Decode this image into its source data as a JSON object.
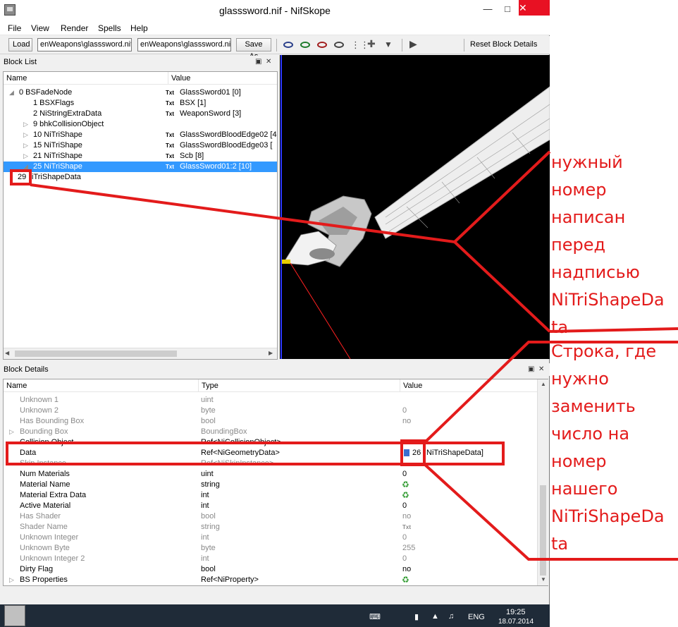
{
  "window": {
    "title": "glasssword.nif - NifSkope"
  },
  "menu": [
    "File",
    "View",
    "Render",
    "Spells",
    "Help"
  ],
  "toolbar": {
    "load_label": "Load",
    "load_path": "enWeapons\\glasssword.nif",
    "save_path": "enWeapons\\glasssword.nif",
    "save_as_label": "Save As",
    "reset_label": "Reset Block Details"
  },
  "block_list": {
    "title": "Block List",
    "col_name": "Name",
    "col_value": "Value",
    "rows": [
      {
        "name": "0 BSFadeNode",
        "value": "GlassSword01 [0]",
        "badge": "Txt"
      },
      {
        "name": "1 BSXFlags",
        "value": "BSX [1]",
        "badge": "Txt"
      },
      {
        "name": "2 NiStringExtraData",
        "value": "WeaponSword [3]",
        "badge": "Txt"
      },
      {
        "name": "9 bhkCollisionObject",
        "value": "",
        "badge": ""
      },
      {
        "name": "10 NiTriShape",
        "value": "GlassSwordBloodEdge02 [4",
        "badge": "Txt"
      },
      {
        "name": "15 NiTriShape",
        "value": "GlassSwordBloodEdge03 [",
        "badge": "Txt"
      },
      {
        "name": "21 NiTriShape",
        "value": "Scb [8]",
        "badge": "Txt"
      },
      {
        "name": "25 NiTriShape",
        "value": "GlassSword01:2 [10]",
        "badge": "Txt"
      },
      {
        "name": "iTriShapeData",
        "value": "",
        "badge": ""
      }
    ],
    "highlight_number": "29"
  },
  "block_details": {
    "title": "Block Details",
    "col_name": "Name",
    "col_type": "Type",
    "col_value": "Value",
    "rows": [
      {
        "name": "Unknown 1",
        "type": "uint",
        "value": ""
      },
      {
        "name": "Unknown 2",
        "type": "byte",
        "value": "0"
      },
      {
        "name": "Has Bounding Box",
        "type": "bool",
        "value": "no"
      },
      {
        "name": "Bounding Box",
        "type": "BoundingBox",
        "value": ""
      },
      {
        "name": "Collision Object",
        "type": "Ref<NiCollisionObject>",
        "value": "none"
      },
      {
        "name": "Data",
        "type": "Ref<NiGeometryData>",
        "value": "26",
        "value_suffix": "NiTriShapeData]"
      },
      {
        "name": "Skin Instance",
        "type": "Ref<NiSkinInstance>",
        "value": ""
      },
      {
        "name": "Num Materials",
        "type": "uint",
        "value": "0"
      },
      {
        "name": "Material Name",
        "type": "string",
        "value": ""
      },
      {
        "name": "Material Extra Data",
        "type": "int",
        "value": ""
      },
      {
        "name": "Active Material",
        "type": "int",
        "value": "0"
      },
      {
        "name": "Has Shader",
        "type": "bool",
        "value": "no"
      },
      {
        "name": "Shader Name",
        "type": "string",
        "value": "Txt"
      },
      {
        "name": "Unknown Integer",
        "type": "int",
        "value": "0"
      },
      {
        "name": "Unknown Byte",
        "type": "byte",
        "value": "255"
      },
      {
        "name": "Unknown Integer 2",
        "type": "int",
        "value": "0"
      },
      {
        "name": "Dirty Flag",
        "type": "bool",
        "value": "no"
      },
      {
        "name": "BS Properties",
        "type": "Ref<NiProperty>",
        "value": ""
      }
    ]
  },
  "taskbar": {
    "lang": "ENG",
    "time": "19:25",
    "date": "18.07.2014"
  },
  "annotations": {
    "note1": [
      "нужный",
      "номер",
      "написан",
      "перед",
      "надписью",
      "NiTriShapeDa",
      "ta"
    ],
    "note2": [
      "Строка, где",
      "нужно",
      "заменить",
      "число на",
      "номер",
      "нашего",
      "NiTriShapeDa",
      "ta"
    ]
  },
  "colors": {
    "annotation": "#e31b1b",
    "selection": "#3399ff",
    "viewport": "#000000"
  }
}
